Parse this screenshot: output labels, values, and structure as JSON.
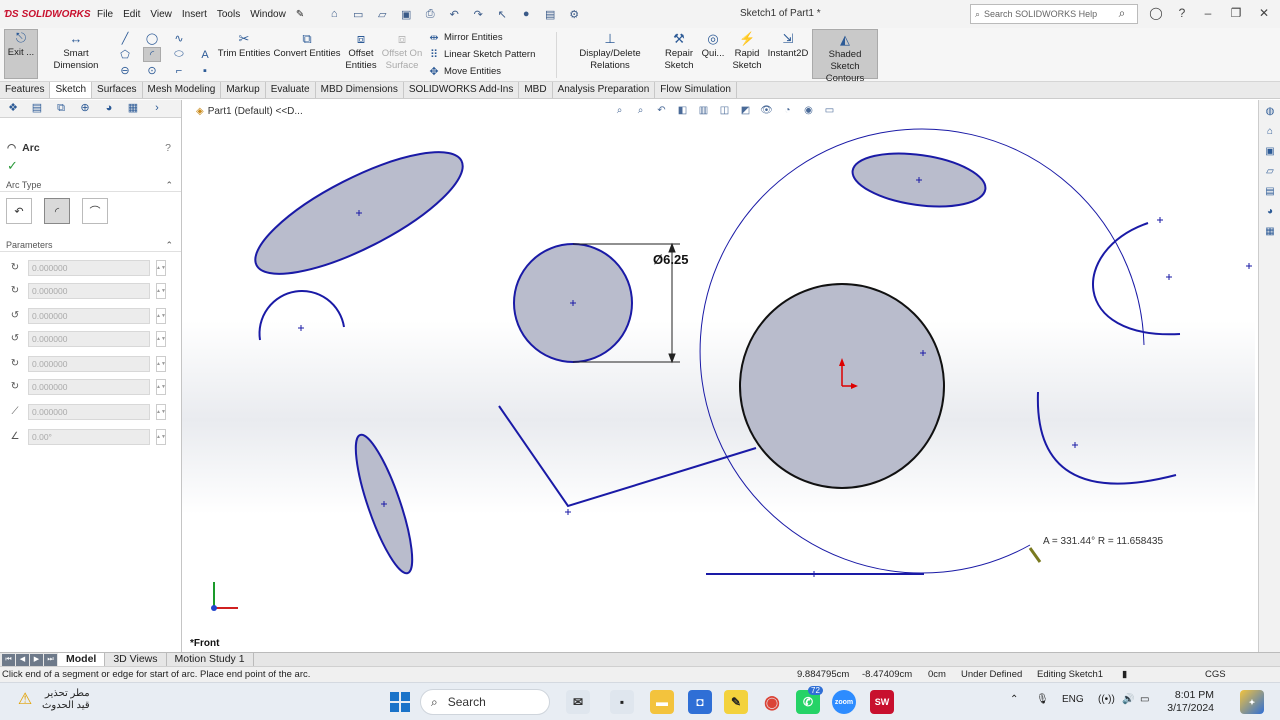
{
  "app": {
    "logo_text": "SOLIDWORKS",
    "menus": [
      "File",
      "Edit",
      "View",
      "Insert",
      "Tools",
      "Window"
    ],
    "doc_title": "Sketch1 of Part1 *",
    "help_search_placeholder": "Search SOLIDWORKS Help"
  },
  "ribbon": {
    "exit_label": "Exit ...",
    "smart_dimension": "Smart Dimension",
    "trim_entities": "Trim Entities",
    "convert_entities": "Convert Entities",
    "offset_entities": "Offset Entities",
    "offset_on_surface": "Offset On Surface",
    "mirror_entities": "Mirror Entities",
    "linear_sketch_pattern": "Linear Sketch Pattern",
    "move_entities": "Move Entities",
    "display_delete_relations": "Display/Delete Relations",
    "repair_sketch": "Repair Sketch",
    "quick_snaps": "Qui...",
    "rapid_sketch": "Rapid Sketch",
    "instant2d": "Instant2D",
    "shaded_sketch_contours": "Shaded Sketch Contours"
  },
  "tabs": [
    "Features",
    "Sketch",
    "Surfaces",
    "Mesh Modeling",
    "Markup",
    "Evaluate",
    "MBD Dimensions",
    "SOLIDWORKS Add-Ins",
    "MBD",
    "Analysis Preparation",
    "Flow Simulation"
  ],
  "active_tab": "Sketch",
  "property_manager": {
    "title": "Arc",
    "arc_type_label": "Arc Type",
    "parameters_label": "Parameters",
    "params": [
      "0.000000",
      "0.000000",
      "0.000000",
      "0.000000",
      "0.000000",
      "0.000000",
      "0.000000",
      "0.00°"
    ]
  },
  "canvas": {
    "breadcrumb": "Part1 (Default) <<D...",
    "view_label": "*Front",
    "dimension_text": "6.25",
    "dimension_symbol": "Ø",
    "arc_readout": "A = 331.44° R = 11.658435",
    "accent_color": "#1a1aa6"
  },
  "bottom_tabs": [
    "Model",
    "3D Views",
    "Motion Study 1"
  ],
  "status": {
    "message": "Click end of a segment or edge for start of arc.  Place end point of the arc.",
    "x": "9.884795cm",
    "y": "-8.47409cm",
    "z": "0cm",
    "state": "Under Defined",
    "editing": "Editing Sketch1",
    "units": "CGS"
  },
  "taskbar": {
    "weather_line1": "مطر تحذير",
    "weather_line2": "قيد الحدوث",
    "search_label": "Search",
    "whatsapp_badge": "72",
    "lang": "ENG",
    "time": "8:01 PM",
    "date": "3/17/2024"
  }
}
